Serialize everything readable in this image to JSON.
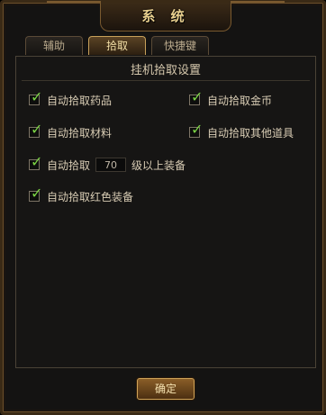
{
  "window": {
    "title": "系 统",
    "close_glyph": "×"
  },
  "tabs": [
    {
      "label": "辅助",
      "active": false
    },
    {
      "label": "拾取",
      "active": true
    },
    {
      "label": "快捷键",
      "active": false
    }
  ],
  "section": {
    "title": "挂机拾取设置"
  },
  "options": {
    "pick_medicine": {
      "label": "自动拾取药品",
      "checked": true
    },
    "pick_gold": {
      "label": "自动拾取金币",
      "checked": true
    },
    "pick_materials": {
      "label": "自动拾取材料",
      "checked": true
    },
    "pick_other_items": {
      "label": "自动拾取其他道具",
      "checked": true
    },
    "pick_equipment": {
      "label_before": "自动拾取",
      "level_value": "70",
      "label_after": "级以上装备",
      "checked": true
    },
    "pick_red_equipment": {
      "label": "自动拾取红色装备",
      "checked": true
    }
  },
  "check_glyph": "✓",
  "footer": {
    "ok_label": "确定"
  },
  "colors": {
    "accent_gold": "#e8cf8e",
    "check_green": "#7ad244",
    "panel_bg": "#161514"
  }
}
